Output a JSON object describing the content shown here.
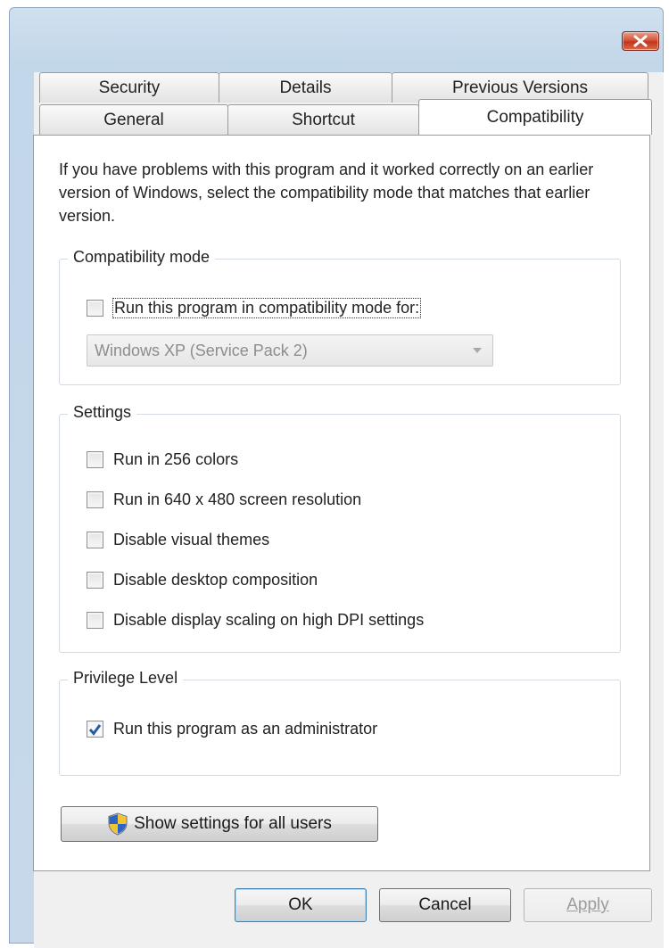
{
  "tabs": {
    "row_back": [
      {
        "label": "Security"
      },
      {
        "label": "Details"
      },
      {
        "label": "Previous Versions"
      }
    ],
    "row_front": [
      {
        "label": "General"
      },
      {
        "label": "Shortcut"
      },
      {
        "label": "Compatibility",
        "active": true
      }
    ]
  },
  "intro_text": "If you have problems with this program and it worked correctly on an earlier version of Windows, select the compatibility mode that matches that earlier version.",
  "compat_mode": {
    "legend": "Compatibility mode",
    "checkbox_label": "Run this program in compatibility mode for:",
    "checked": false,
    "dropdown_value": "Windows XP (Service Pack 2)"
  },
  "settings": {
    "legend": "Settings",
    "options": [
      {
        "label": "Run in 256 colors",
        "checked": false
      },
      {
        "label": "Run in 640 x 480 screen resolution",
        "checked": false
      },
      {
        "label": "Disable visual themes",
        "checked": false
      },
      {
        "label": "Disable desktop composition",
        "checked": false
      },
      {
        "label": "Disable display scaling on high DPI settings",
        "checked": false
      }
    ]
  },
  "privilege": {
    "legend": "Privilege Level",
    "checkbox_label": "Run this program as an administrator",
    "checked": true
  },
  "show_all_users_button": "Show settings for all users",
  "footer": {
    "ok": "OK",
    "cancel": "Cancel",
    "apply": "Apply"
  },
  "colors": {
    "accent_check": "#2a5aa0",
    "close_button": "#c2351a"
  },
  "icons": {
    "close": "close-x-icon",
    "shield": "uac-shield-icon",
    "dropdown_arrow": "chevron-down-icon",
    "checkmark": "checkmark-icon"
  }
}
